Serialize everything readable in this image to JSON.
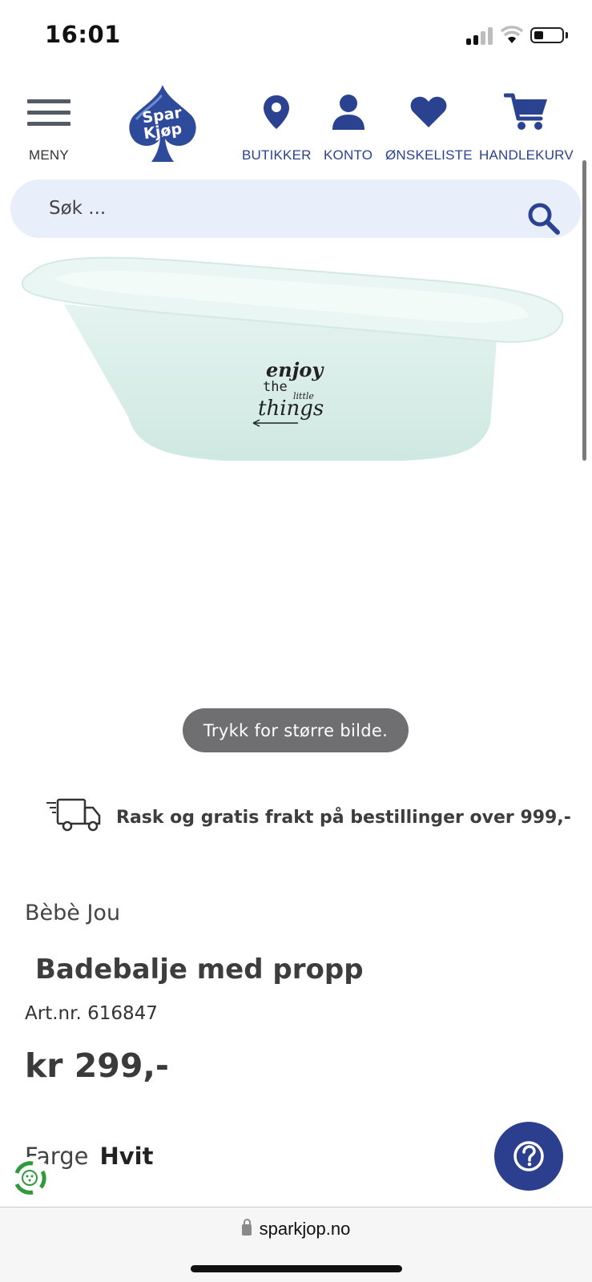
{
  "status_bar": {
    "time": "16:01"
  },
  "header": {
    "menu_label": "MENY",
    "logo_text": "Spar Kjøp",
    "nav": [
      {
        "label": "BUTIKKER",
        "icon": "location-pin-icon"
      },
      {
        "label": "KONTO",
        "icon": "user-icon"
      },
      {
        "label": "ØNSKELISTE",
        "icon": "heart-icon"
      },
      {
        "label": "HANDLEKURV",
        "icon": "cart-icon"
      }
    ],
    "brand_color": "#2b4291"
  },
  "search": {
    "placeholder": "Søk ..."
  },
  "product": {
    "image_caption": "Trykk for større bilde.",
    "image_print_text": "enjoy the little things",
    "shipping_text": "Rask og gratis frakt på bestillinger over 999,-",
    "brand": "Bèbè Jou",
    "title": "Badebalje med propp",
    "art_nr": "Art.nr. 616847",
    "price": "kr 299,-",
    "color_label": "Farge",
    "color_value": "Hvit"
  },
  "browser": {
    "url": "sparkjop.no"
  }
}
